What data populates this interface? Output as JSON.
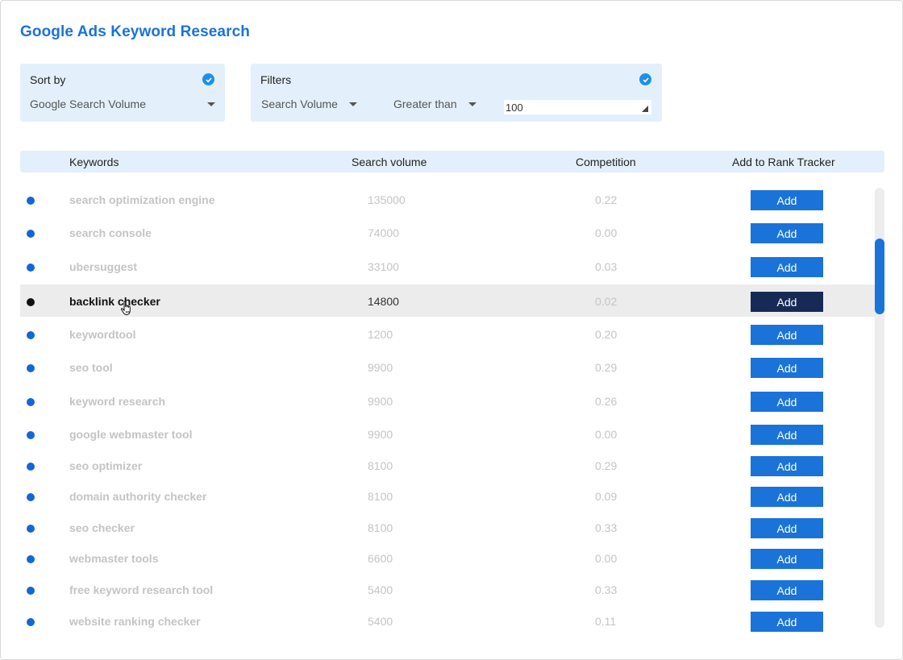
{
  "title": "Google Ads Keyword Research",
  "sort": {
    "label": "Sort by",
    "selected": "Google Search Volume"
  },
  "filters": {
    "label": "Filters",
    "metric": "Search Volume",
    "operator": "Greater than",
    "value": "100"
  },
  "table": {
    "headers": {
      "keywords": "Keywords",
      "search_volume": "Search volume",
      "competition": "Competition",
      "add": "Add to Rank Tracker"
    },
    "rows": [
      {
        "keyword": "search optimization engine",
        "volume": "135000",
        "competition": "0.22",
        "button": "Add"
      },
      {
        "keyword": "search console",
        "volume": "74000",
        "competition": "0.00",
        "button": "Add"
      },
      {
        "keyword": "ubersuggest",
        "volume": "33100",
        "competition": "0.03",
        "button": "Add"
      },
      {
        "keyword": "backlink checker",
        "volume": "14800",
        "competition": "0.02",
        "button": "Add"
      },
      {
        "keyword": "keywordtool",
        "volume": "1200",
        "competition": "0.20",
        "button": "Add"
      },
      {
        "keyword": "seo tool",
        "volume": "9900",
        "competition": "0.29",
        "button": "Add"
      },
      {
        "keyword": "keyword research",
        "volume": "9900",
        "competition": "0.26",
        "button": "Add"
      },
      {
        "keyword": "google webmaster tool",
        "volume": "9900",
        "competition": "0.00",
        "button": "Add"
      },
      {
        "keyword": "seo optimizer",
        "volume": "8100",
        "competition": "0.29",
        "button": "Add"
      },
      {
        "keyword": "domain authority checker",
        "volume": "8100",
        "competition": "0.09",
        "button": "Add"
      },
      {
        "keyword": "seo checker",
        "volume": "8100",
        "competition": "0.33",
        "button": "Add"
      },
      {
        "keyword": "webmaster tools",
        "volume": "6600",
        "competition": "0.00",
        "button": "Add"
      },
      {
        "keyword": "free keyword research tool",
        "volume": "5400",
        "competition": "0.33",
        "button": "Add"
      },
      {
        "keyword": "website ranking checker",
        "volume": "5400",
        "competition": "0.11",
        "button": "Add"
      }
    ]
  },
  "colors": {
    "accent": "#1a73d9",
    "panel_bg": "#e3f0fb",
    "highlight_button": "#172a55"
  },
  "icons": {
    "check": "check-circle-icon",
    "dropdown": "chevron-down-icon",
    "cursor": "hand-pointer-icon"
  }
}
